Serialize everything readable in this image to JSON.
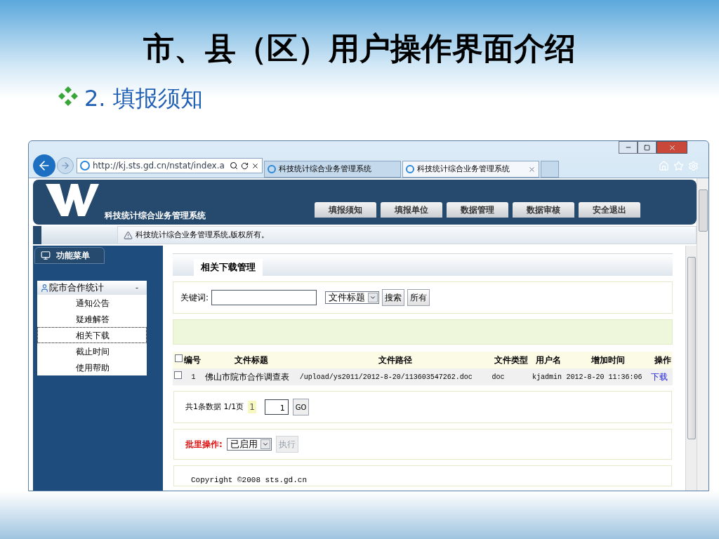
{
  "slide": {
    "title": "市、县（区）用户操作界面介绍",
    "heading": "2. 填报须知"
  },
  "browser": {
    "address": "http://kj.sts.gd.cn/nstat/index.a",
    "tabs": [
      {
        "label": "科技统计综合业务管理系统",
        "selected": false
      },
      {
        "label": "科技统计综合业务管理系统",
        "selected": true
      }
    ]
  },
  "header": {
    "system_name": "科技统计综合业务管理系统",
    "nav": [
      "填报须知",
      "填报单位",
      "数据管理",
      "数据审核",
      "安全退出"
    ]
  },
  "notice": "科技统计综合业务管理系统,版权所有。",
  "sidebar": {
    "title": "功能菜单",
    "group": {
      "label": "院市合作统计",
      "toggle": "-",
      "expanded": true,
      "items": [
        {
          "label": "通知公告",
          "selected": false
        },
        {
          "label": "疑难解答",
          "selected": false
        },
        {
          "label": "相关下载",
          "selected": true
        },
        {
          "label": "截止时间",
          "selected": false
        },
        {
          "label": "使用帮助",
          "selected": false
        }
      ]
    }
  },
  "main": {
    "section_title": "相关下载管理",
    "search": {
      "label": "关键词:",
      "select": "文件标题",
      "buttons": [
        "搜索",
        "所有"
      ]
    },
    "table": {
      "header_checked": false,
      "columns": [
        "编号",
        "文件标题",
        "文件路径",
        "文件类型",
        "用户名",
        "增加时间",
        "操作"
      ],
      "rows": [
        {
          "checked": false,
          "cells": [
            "1",
            "佛山市院市合作调查表",
            "/upload/ys2011/2012-8-20/113603547262.doc",
            "doc",
            "kjadmin",
            "2012-8-20 11:36:06"
          ],
          "action": "下载"
        }
      ]
    },
    "pagination": {
      "summary": "共1条数据 1/1页",
      "current": "1",
      "page_input": "1",
      "go": "GO"
    },
    "batch": {
      "label": "批里操作:",
      "select": "已启用",
      "button": "执行",
      "button_disabled": true
    },
    "copyright": "Copyright ©2008 sts.gd.cn"
  }
}
